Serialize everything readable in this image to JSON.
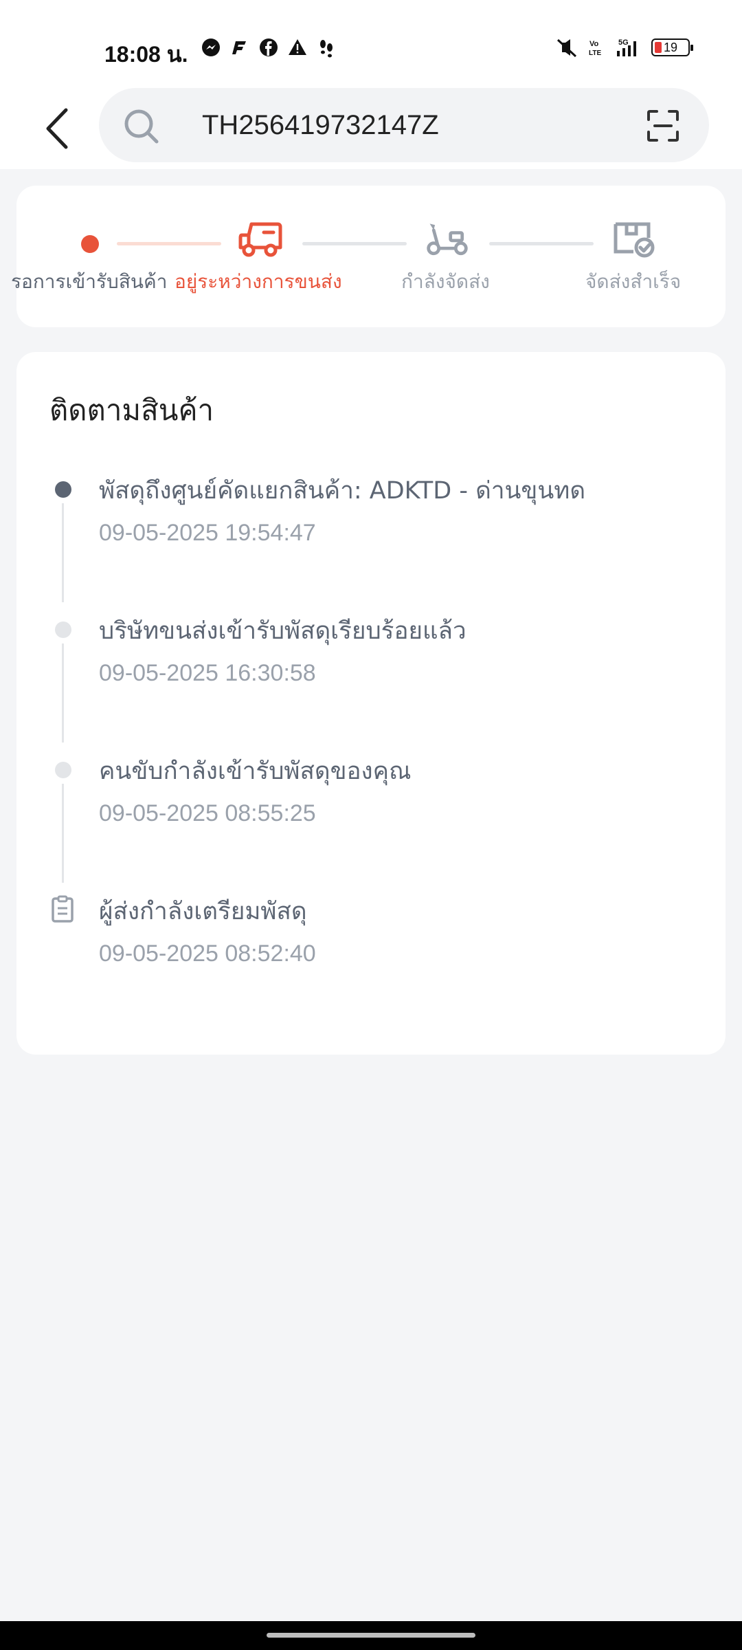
{
  "status_bar": {
    "time": "18:08 น.",
    "battery": "19",
    "left_icons": [
      "messenger-icon",
      "f-app-icon",
      "facebook-icon",
      "warning-icon",
      "footsteps-icon"
    ],
    "right_icons": [
      "mute-icon",
      "volte-icon",
      "signal-5g-icon",
      "battery-icon"
    ]
  },
  "search": {
    "value": "TH256419732147Z"
  },
  "progress": {
    "accent_color": "#e8533a",
    "inactive_color": "#9aa1ab",
    "steps": [
      {
        "label": "รอการเข้ารับสินค้า",
        "icon": "dot-icon",
        "state": "done"
      },
      {
        "label": "อยู่ระหว่างการขนส่ง",
        "icon": "truck-icon",
        "state": "current"
      },
      {
        "label": "กำลังจัดส่ง",
        "icon": "scooter-icon",
        "state": "pending"
      },
      {
        "label": "จัดส่งสำเร็จ",
        "icon": "box-check-icon",
        "state": "pending"
      }
    ]
  },
  "tracking": {
    "title": "ติดตามสินค้า",
    "events": [
      {
        "title": "พัสดุถึงศูนย์คัดแยกสินค้า: ADKTD - ด่านขุนทด",
        "time": "09-05-2025 19:54:47"
      },
      {
        "title": "บริษัทขนส่งเข้ารับพัสดุเรียบร้อยแล้ว",
        "time": "09-05-2025 16:30:58"
      },
      {
        "title": "คนขับกำลังเข้ารับพัสดุของคุณ",
        "time": "09-05-2025 08:55:25"
      },
      {
        "title": "ผู้ส่งกำลังเตรียมพัสดุ",
        "time": "09-05-2025 08:52:40"
      }
    ]
  }
}
